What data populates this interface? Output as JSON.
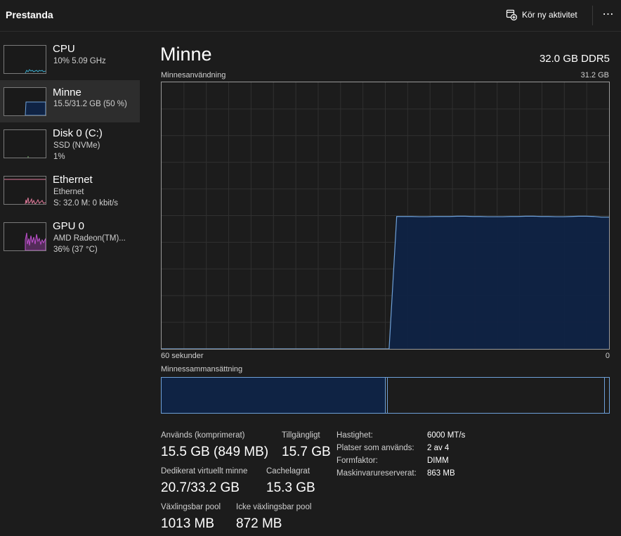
{
  "header": {
    "title": "Prestanda",
    "run_task_label": "Kör ny aktivitet",
    "more_label": "⋯"
  },
  "sidebar": {
    "items": [
      {
        "name": "CPU",
        "line1": "10%  5.09 GHz",
        "line2": ""
      },
      {
        "name": "Minne",
        "line1": "15.5/31.2 GB (50 %)",
        "line2": ""
      },
      {
        "name": "Disk 0 (C:)",
        "line1": "SSD (NVMe)",
        "line2": "1%"
      },
      {
        "name": "Ethernet",
        "line1": "Ethernet",
        "line2": "S: 32.0  M: 0 kbit/s"
      },
      {
        "name": "GPU 0",
        "line1": "AMD Radeon(TM)...",
        "line2": "36%  (37 °C)"
      }
    ]
  },
  "main": {
    "title": "Minne",
    "spec": "32.0 GB DDR5",
    "usage_label": "Minnesanvändning",
    "usage_max": "31.2 GB",
    "time_left": "60 sekunder",
    "time_right": "0",
    "composition_label": "Minnessammansättning",
    "stats": {
      "in_use_label": "Används (komprimerat)",
      "in_use_value": "15.5 GB (849 MB)",
      "available_label": "Tillgängligt",
      "available_value": "15.7 GB",
      "committed_label": "Dedikerat virtuellt minne",
      "committed_value": "20.7/33.2 GB",
      "cached_label": "Cachelagrat",
      "cached_value": "15.3 GB",
      "paged_label": "Växlingsbar pool",
      "paged_value": "1013 MB",
      "nonpaged_label": "Icke växlingsbar pool",
      "nonpaged_value": "872 MB"
    },
    "details": [
      {
        "key": "Hastighet:",
        "value": "6000 MT/s"
      },
      {
        "key": "Platser som används:",
        "value": "2 av 4"
      },
      {
        "key": "Formfaktor:",
        "value": "DIMM"
      },
      {
        "key": "Maskinvarureserverat:",
        "value": "863 MB"
      }
    ]
  },
  "graph_data": {
    "max_gb": 31.2,
    "samples_gb": [
      0,
      0,
      0,
      0,
      0,
      0,
      0,
      0,
      0,
      0,
      0,
      0,
      0,
      0,
      0,
      0,
      0,
      0,
      0,
      0,
      0,
      0,
      0,
      0,
      0,
      0,
      0,
      0,
      0,
      0,
      0,
      15.5,
      15.5,
      15.5,
      15.47,
      15.47,
      15.5,
      15.5,
      15.5,
      15.53,
      15.53,
      15.5,
      15.5,
      15.47,
      15.47,
      15.47,
      15.5,
      15.5,
      15.53,
      15.53,
      15.5,
      15.5,
      15.47,
      15.47,
      15.5,
      15.53,
      15.53,
      15.5,
      15.42,
      15.42
    ]
  },
  "colors": {
    "accent": "#6ea0d8",
    "memory_fill": "#0f2344",
    "gpu": "#c050d0",
    "ethernet": "#e07a9a",
    "cpu": "#3aa8c8"
  },
  "icons": {
    "run_task": "new-task-icon",
    "more": "more-icon"
  }
}
